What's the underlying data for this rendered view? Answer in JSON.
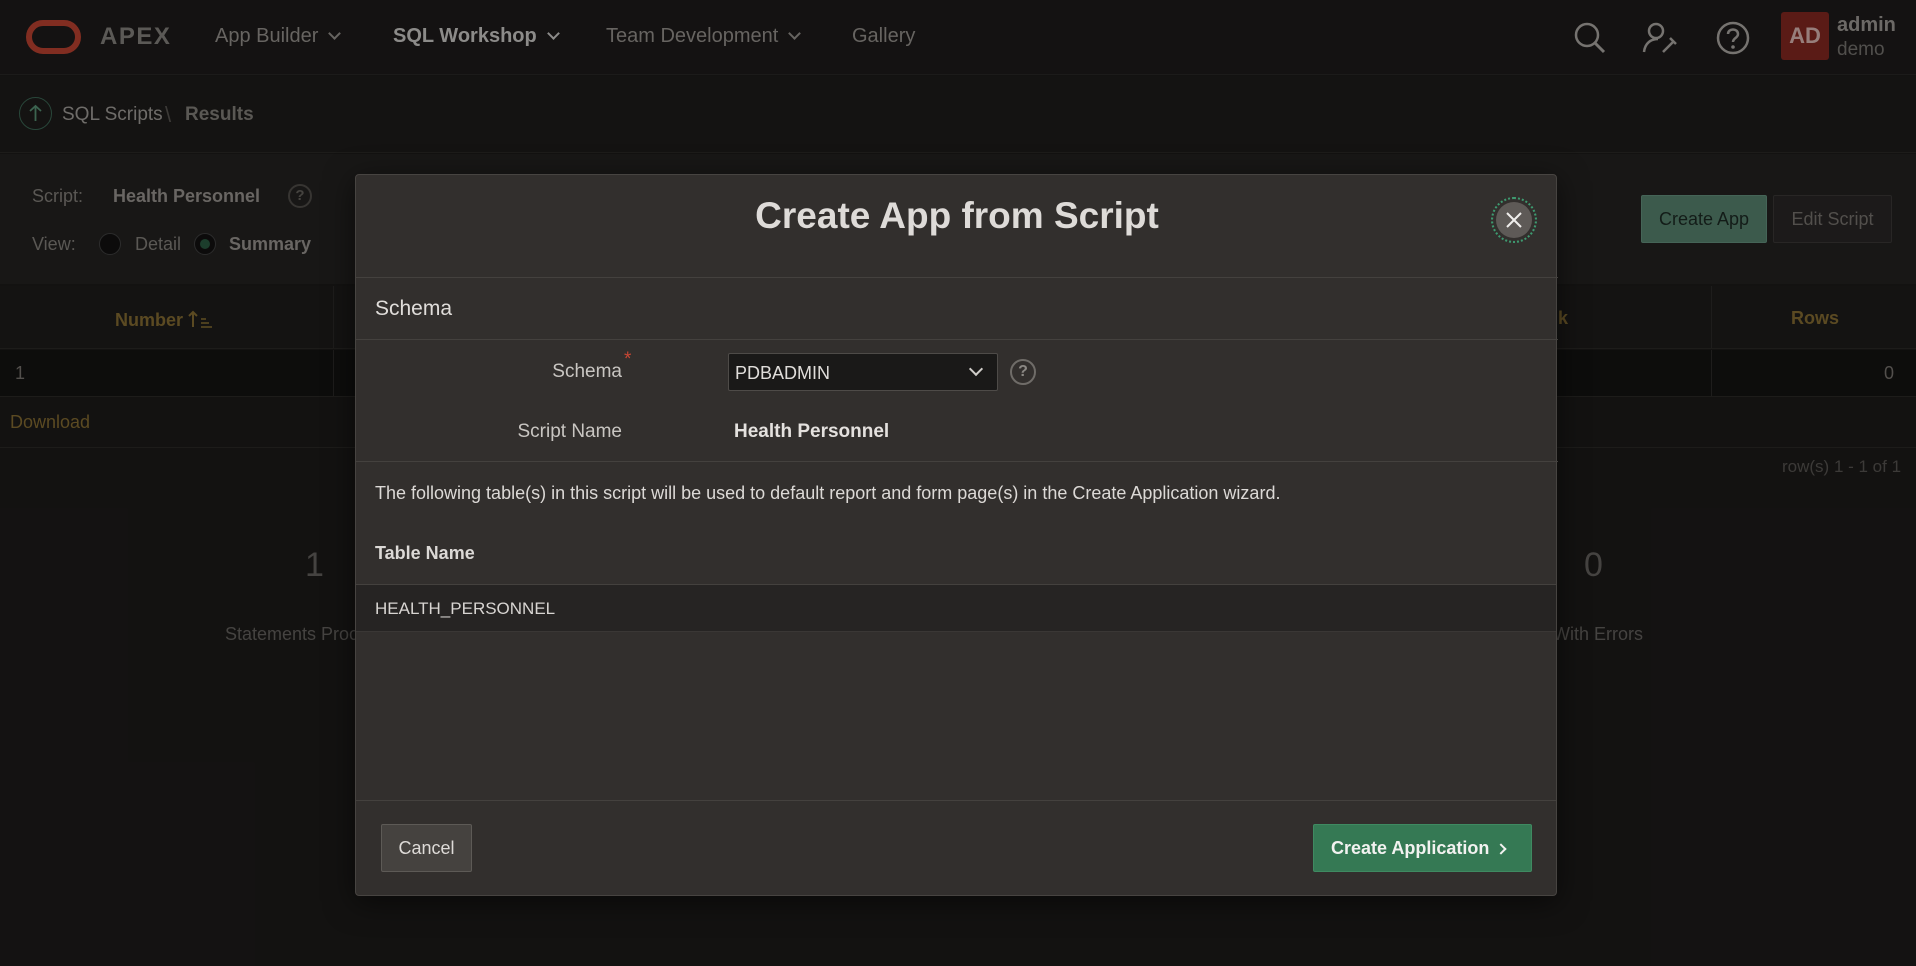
{
  "header": {
    "brand": "APEX",
    "nav": [
      {
        "label": "App Builder"
      },
      {
        "label": "SQL Workshop"
      },
      {
        "label": "Team Development"
      },
      {
        "label": "Gallery"
      }
    ],
    "user": {
      "initials": "AD",
      "name": "admin",
      "workspace": "demo"
    },
    "icons": [
      "search-icon",
      "admin-tools-icon",
      "help-icon"
    ]
  },
  "breadcrumb": {
    "parent": "SQL Scripts",
    "current": "Results"
  },
  "page": {
    "script_label": "Script:",
    "script_value": "Health Personnel",
    "view_label": "View:",
    "view_detail": "Detail",
    "view_summary": "Summary",
    "create_app_label": "Create App",
    "edit_script_label": "Edit Script",
    "table": {
      "col_number": "Number",
      "col_rows_partial": "k",
      "col_rows": "Rows",
      "row_number": "1",
      "row_rows": "0"
    },
    "download": "Download",
    "row_count": "row(s) 1 - 1 of 1",
    "stat_left_value": "1",
    "stat_left_label": "Statements Proc",
    "stat_right_value": "0",
    "stat_right_label": "With Errors"
  },
  "dialog": {
    "title": "Create App from Script",
    "region_title": "Schema",
    "schema_label": "Schema",
    "schema_value": "PDBADMIN",
    "script_name_label": "Script Name",
    "script_name_value": "Health Personnel",
    "info_text": "The following table(s) in this script will be used to default report and form page(s) in the Create Application wizard.",
    "table_header": "Table Name",
    "table_rows": [
      "HEALTH_PERSONNEL"
    ],
    "cancel_label": "Cancel",
    "create_label": "Create Application"
  },
  "colors": {
    "accent": "#357954",
    "brand": "#c74634",
    "link": "#8d7235"
  }
}
